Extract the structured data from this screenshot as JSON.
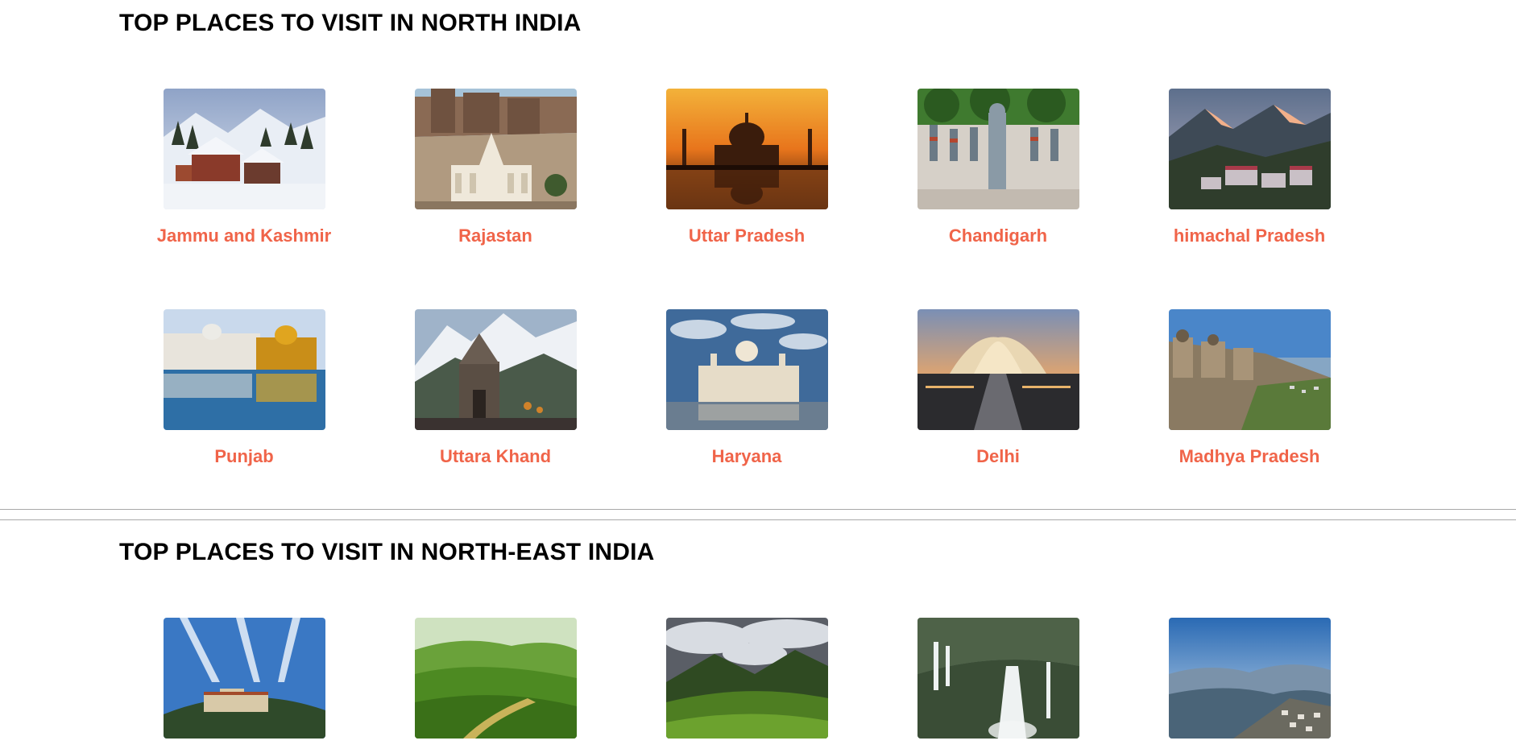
{
  "north": {
    "title": "TOP PLACES TO VISIT IN NORTH INDIA",
    "places": [
      {
        "name": "Jammu and Kashmir",
        "photo": "snowy-village"
      },
      {
        "name": "Rajastan",
        "photo": "fort-palace"
      },
      {
        "name": "Uttar Pradesh",
        "photo": "taj-mahal-sunset"
      },
      {
        "name": "Chandigarh",
        "photo": "rock-garden-statues"
      },
      {
        "name": "himachal Pradesh",
        "photo": "mountain-town"
      },
      {
        "name": "Punjab",
        "photo": "golden-temple"
      },
      {
        "name": "Uttara Khand",
        "photo": "kedarnath-temple"
      },
      {
        "name": "Haryana",
        "photo": "palace-lake"
      },
      {
        "name": "Delhi",
        "photo": "lotus-temple"
      },
      {
        "name": "Madhya Pradesh",
        "photo": "gwalior-fort"
      }
    ]
  },
  "northeast": {
    "title": "TOP PLACES TO VISIT IN NORTH-EAST INDIA",
    "places": [
      {
        "name": "",
        "photo": "monastery-hill"
      },
      {
        "name": "",
        "photo": "tea-terraces"
      },
      {
        "name": "",
        "photo": "green-hills-clouds"
      },
      {
        "name": "",
        "photo": "waterfall"
      },
      {
        "name": "",
        "photo": "misty-valley-town"
      }
    ]
  },
  "colors": {
    "caption": "#f06449",
    "title": "#000000",
    "divider": "#a9a9a9"
  }
}
